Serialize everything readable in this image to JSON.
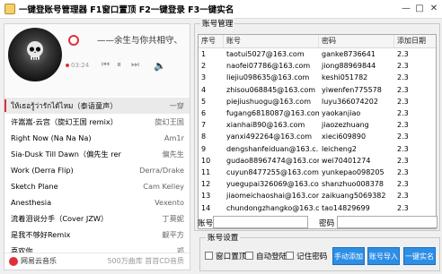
{
  "window": {
    "title": "一键登账号管理器 F1窗口置顶 F2一键登录 F3一键实名",
    "minimize": "—",
    "maximize": "□",
    "close": "✕"
  },
  "music": {
    "now_playing": {
      "dash": "—",
      "title": "——余生与你共相守、",
      "time": "03:24"
    },
    "songs": [
      {
        "name": "ให้เธอรู้ว่ารักได้ไหม（泰语童声）",
        "artist": "一穿"
      },
      {
        "name": "许嵩嵩-云宫（旋幻王国 remix）",
        "artist": "旋幻王国"
      },
      {
        "name": "Right Now (Na Na Na)",
        "artist": "Am1r"
      },
      {
        "name": "Sia-Dusk Till Dawn（偏先生 rer",
        "artist": "偏先生"
      },
      {
        "name": "Work (Derra Flip)",
        "artist": "Derra/Drake"
      },
      {
        "name": "Sketch Plane",
        "artist": "Cam Kelley"
      },
      {
        "name": "Anesthesia",
        "artist": "Vexento"
      },
      {
        "name": "流着泪说分手（Cover JZW）",
        "artist": "丁莫妮"
      },
      {
        "name": "是我不够好Remix",
        "artist": "靓平方"
      },
      {
        "name": "喜欢你",
        "artist": "邓"
      }
    ],
    "footer": {
      "brand": "网易云音乐",
      "tagline": "500万曲库 首首CD音质"
    }
  },
  "account": {
    "group_label": "账号管理",
    "columns": [
      "序号",
      "账号",
      "密码",
      "添加日期"
    ],
    "rows": [
      [
        "1",
        "taotui5027@163.com",
        "ganke8736641",
        "2.3"
      ],
      [
        "2",
        "naofei07786@163.com",
        "jiong88969844",
        "2.3"
      ],
      [
        "3",
        "liejiu098635@163.com",
        "keshi051782",
        "2.3"
      ],
      [
        "4",
        "zhisou068845@163.com",
        "yiwenfen775578",
        "2.3"
      ],
      [
        "5",
        "piejiushuogu@163.com",
        "luyu366074202",
        "2.3"
      ],
      [
        "6",
        "fugang6818087@163.com",
        "yaokanjiao",
        "2.3"
      ],
      [
        "7",
        "xianhai890@163.com",
        "jiaozezhuang",
        "2.3"
      ],
      [
        "8",
        "yanxi492264@163.com",
        "xieci609890",
        "2.3"
      ],
      [
        "9",
        "dengshanfeiduan@163.c...",
        "leicheng2",
        "2.3"
      ],
      [
        "10",
        "gudao88967474@163.com",
        "wei70401274",
        "2.3"
      ],
      [
        "11",
        "cuyun8477255@163.com",
        "yunkepao098205",
        "2.3"
      ],
      [
        "12",
        "yuegupai326069@163.com",
        "shanzhuo008378",
        "2.3"
      ],
      [
        "13",
        "jiaomeichaoshai@163.com",
        "zaikuang5069382",
        "2.3"
      ],
      [
        "14",
        "chundongzhangko@163.com",
        "tao14829699",
        "2.3"
      ]
    ],
    "account_label": "账号",
    "password_label": "密码",
    "account_value": "",
    "password_value": ""
  },
  "settings": {
    "group_label": "账号设置",
    "checkboxes": [
      "窗口置顶",
      "自动登陆",
      "记住密码"
    ],
    "buttons": [
      "手动添加",
      "账号导入",
      "一键实名"
    ]
  },
  "colors": {
    "accent_red": "#e0303a",
    "button_blue": "#2d8ee6"
  }
}
